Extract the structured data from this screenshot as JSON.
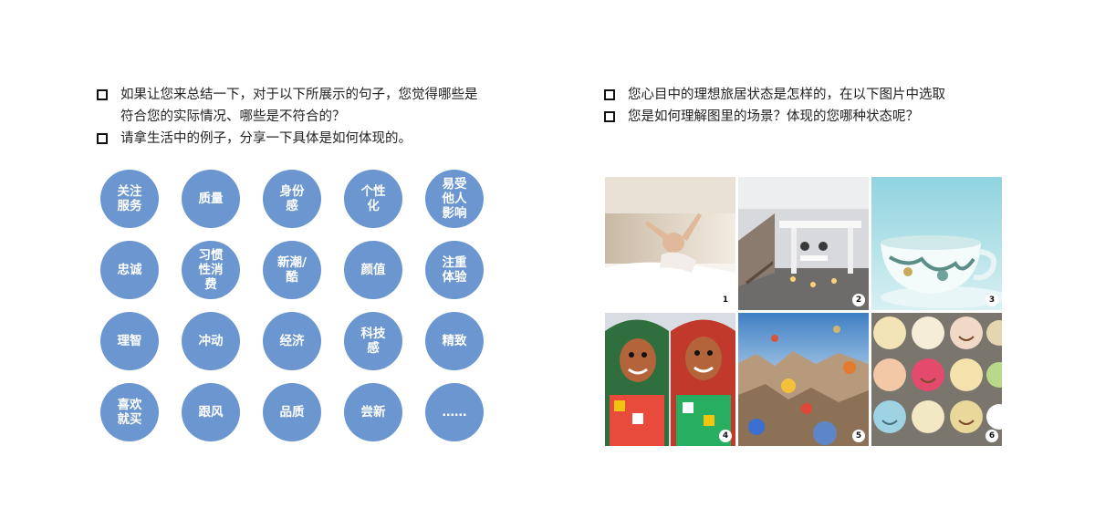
{
  "left_questions": [
    "如果让您来总结一下，对于以下所展示的句子，您觉得哪些是符合您的实际情况、哪些是不符合的？",
    "请拿生活中的例子，分享一下具体是如何体现的。"
  ],
  "right_questions": [
    "您心目中的理想旅居状态是怎样的，在以下图片中选取",
    "您是如何理解图里的场景？体现的您哪种状态呢？"
  ],
  "circles": [
    "关注\n服务",
    "质量",
    "身份\n感",
    "个性\n化",
    "易受\n他人\n影响",
    "忠诚",
    "习惯\n性消\n费",
    "新潮/\n酷",
    "颜值",
    "注重\n体验",
    "理智",
    "冲动",
    "经济",
    "科技\n感",
    "精致",
    "喜欢\n就买",
    "跟风",
    "品质",
    "尝新",
    "……"
  ],
  "photo_numbers": [
    "1",
    "2",
    "3",
    "4",
    "5",
    "6"
  ],
  "colors": {
    "circle_fill": "#6b96cf"
  }
}
